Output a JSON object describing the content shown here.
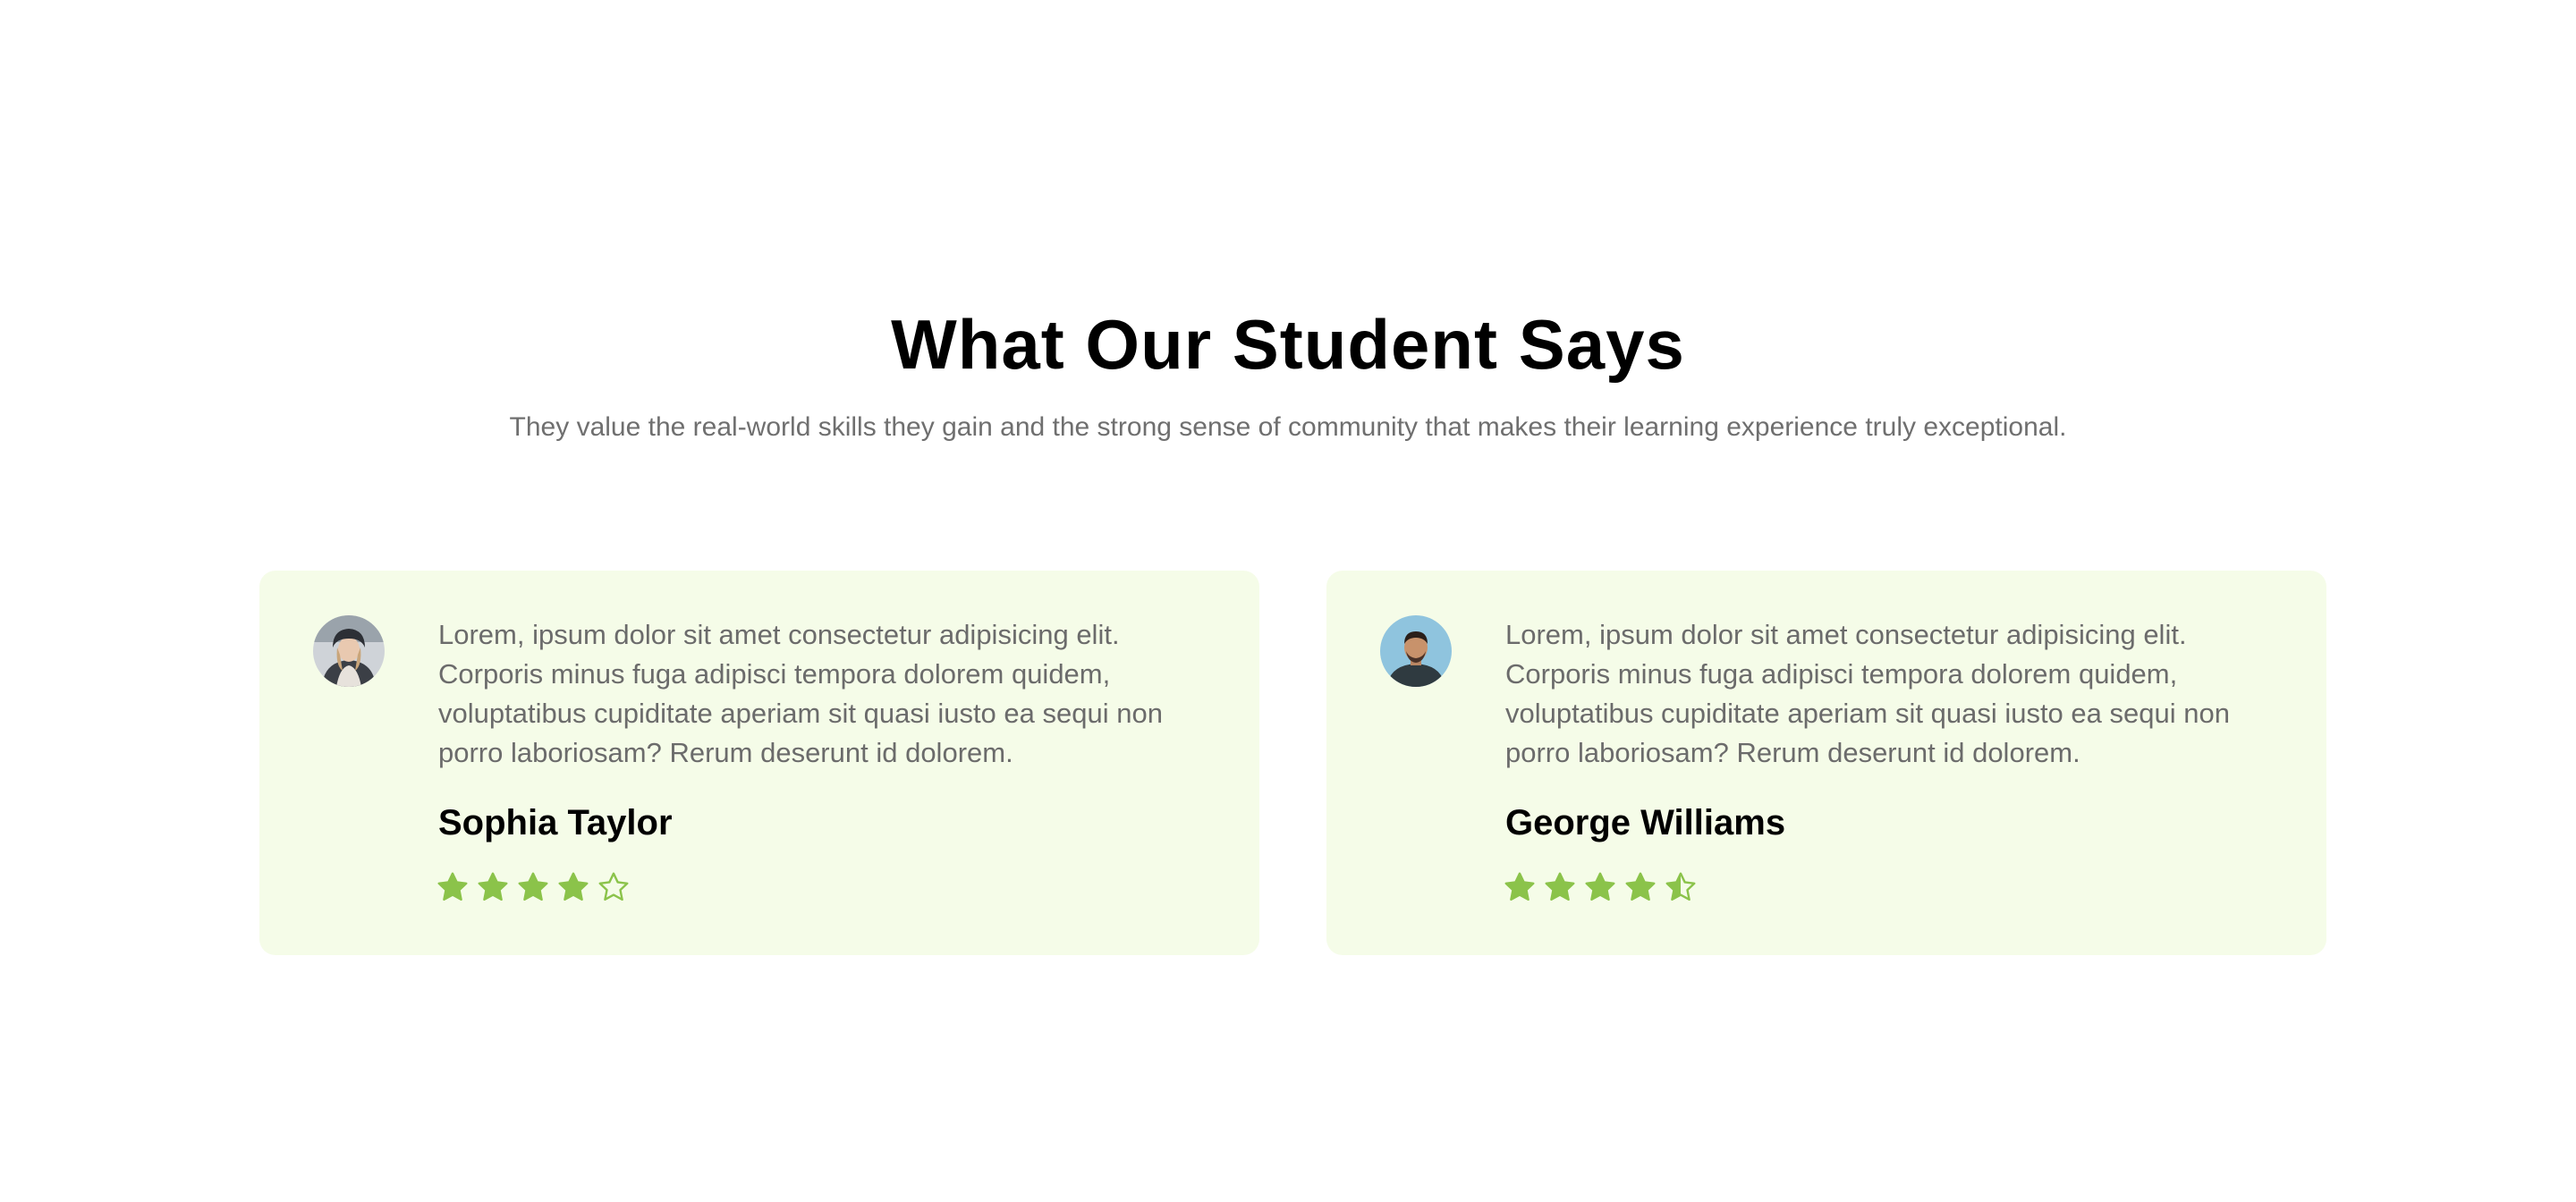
{
  "section": {
    "title": "What Our Student Says",
    "subtitle": "They value the real-world skills they gain and the strong sense of community that makes their learning experience truly exceptional."
  },
  "colors": {
    "card_background": "#f5fce8",
    "star_accent": "#8bc34a",
    "body_text": "#6b6b6b",
    "heading_text": "#000000"
  },
  "testimonials": [
    {
      "name": "Sophia Taylor",
      "quote": "Lorem, ipsum dolor sit amet consectetur adipisicing elit. Corporis minus fuga adipisci tempora dolorem quidem, voluptatibus cupiditate aperiam sit quasi iusto ea sequi non porro laboriosam? Rerum deserunt id dolorem.",
      "avatar_icon": "avatar-woman-icon",
      "rating": 4,
      "rating_max": 5
    },
    {
      "name": "George Williams",
      "quote": "Lorem, ipsum dolor sit amet consectetur adipisicing elit. Corporis minus fuga adipisci tempora dolorem quidem, voluptatibus cupiditate aperiam sit quasi iusto ea sequi non porro laboriosam? Rerum deserunt id dolorem.",
      "avatar_icon": "avatar-man-icon",
      "rating": 4.5,
      "rating_max": 5
    }
  ]
}
